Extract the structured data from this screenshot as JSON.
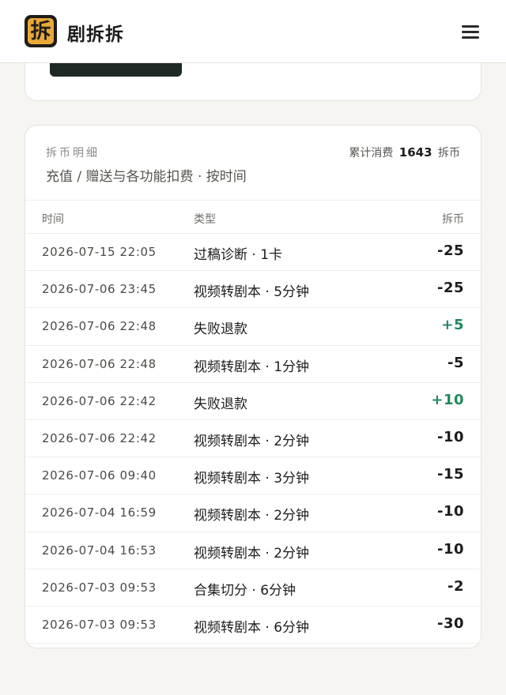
{
  "header": {
    "logo_char": "拆",
    "brand": "剧拆拆"
  },
  "ledger": {
    "title": "拆币明细",
    "subtitle": "充值 / 赠送与各功能扣费 · 按时间",
    "total_label": "累计消费",
    "total_value": "1643",
    "total_unit": "拆币",
    "columns": {
      "time": "时间",
      "type": "类型",
      "amount": "拆币"
    },
    "rows": [
      {
        "time": "2026-07-15 22:05",
        "type": "过稿诊断 · 1卡",
        "amount": "-25"
      },
      {
        "time": "2026-07-06 23:45",
        "type": "视频转剧本 · 5分钟",
        "amount": "-25"
      },
      {
        "time": "2026-07-06 22:48",
        "type": "失败退款",
        "amount": "+5"
      },
      {
        "time": "2026-07-06 22:48",
        "type": "视频转剧本 · 1分钟",
        "amount": "-5"
      },
      {
        "time": "2026-07-06 22:42",
        "type": "失败退款",
        "amount": "+10"
      },
      {
        "time": "2026-07-06 22:42",
        "type": "视频转剧本 · 2分钟",
        "amount": "-10"
      },
      {
        "time": "2026-07-06 09:40",
        "type": "视频转剧本 · 3分钟",
        "amount": "-15"
      },
      {
        "time": "2026-07-04 16:59",
        "type": "视频转剧本 · 2分钟",
        "amount": "-10"
      },
      {
        "time": "2026-07-04 16:53",
        "type": "视频转剧本 · 2分钟",
        "amount": "-10"
      },
      {
        "time": "2026-07-03 09:53",
        "type": "合集切分 · 6分钟",
        "amount": "-2"
      },
      {
        "time": "2026-07-03 09:53",
        "type": "视频转剧本 · 6分钟",
        "amount": "-30"
      }
    ]
  },
  "colors": {
    "accent": "#e9a93a",
    "positive": "#1f8a5b",
    "background": "#f6f5f1"
  },
  "icons": {
    "menu": "hamburger-menu-icon"
  }
}
